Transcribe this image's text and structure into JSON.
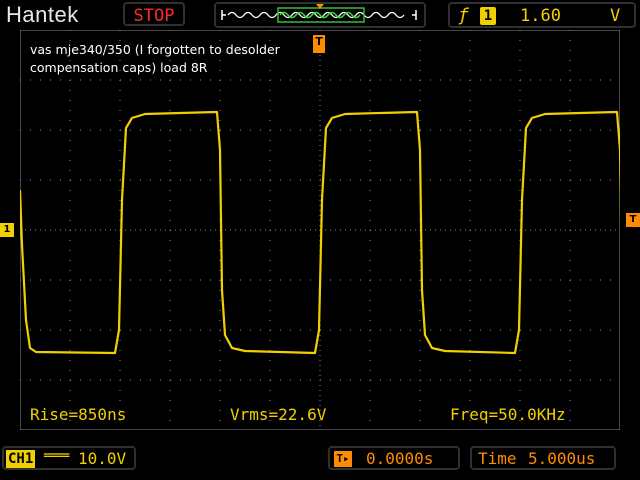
{
  "header": {
    "brand": "Hantek",
    "run_state": "STOP",
    "trigger": {
      "edge_icon": "rising-edge-icon",
      "channel": "1",
      "level": "1.60",
      "unit": "V"
    }
  },
  "caption": {
    "line1": "vas mje340/350 (I forgotten to desolder",
    "line2": "compensation caps) load 8R"
  },
  "measurements": {
    "rise": "Rise=850ns",
    "vrms": "Vrms=22.6V",
    "freq": "Freq=50.0KHz"
  },
  "markers": {
    "trigger_top": "T",
    "channel": "1",
    "level": "T"
  },
  "footer": {
    "channel_tag": "CH1",
    "coupling_icon": "dc-coupling-icon",
    "volts_div": "10.0V",
    "trigger_pos_icon": "trigger-position-icon",
    "trigger_pos": "0.0000s",
    "time_label": "Time",
    "time_div": "5.000us"
  },
  "colors": {
    "trace": "#f0d000",
    "trigger": "#ff8c00",
    "stop": "#ff2a2a"
  }
}
